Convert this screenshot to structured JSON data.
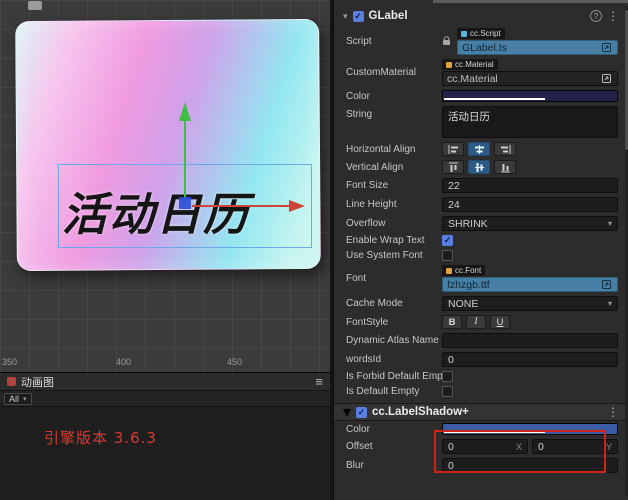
{
  "icons": {
    "menu_dots": "⋮",
    "hamburger": "≡",
    "chevron_down": "▾",
    "collapse_open": "▾",
    "help": "?",
    "check": "✓"
  },
  "colors": {
    "accent_blue": "#5a7fe0",
    "asset_highlight": "#477ea3",
    "annotation_red": "#cf2318",
    "label_color_value": "#23224A",
    "shadow_color_value": "#3D5CA6"
  },
  "scene": {
    "ruler_labels": [
      "350",
      "400",
      "450"
    ],
    "card_text": "活动日历",
    "timeline_tab": "动画图",
    "filter_value": "All",
    "annotation": "引擎版本 3.6.3"
  },
  "inspector": {
    "title": "GLabel",
    "fields": {
      "script": {
        "label": "Script",
        "type": "cc.Script",
        "value": "GLabel.ts"
      },
      "custom_material": {
        "label": "CustomMaterial",
        "type": "cc.Material",
        "value": "cc.Material"
      },
      "color": {
        "label": "Color",
        "value": "#23224A"
      },
      "string": {
        "label": "String",
        "value": "活动日历"
      },
      "horizontal_align": {
        "label": "Horizontal Align"
      },
      "vertical_align": {
        "label": "Vertical Align"
      },
      "font_size": {
        "label": "Font Size",
        "value": "22"
      },
      "line_height": {
        "label": "Line Height",
        "value": "24"
      },
      "overflow": {
        "label": "Overflow",
        "value": "SHRINK"
      },
      "enable_wrap_text": {
        "label": "Enable Wrap Text",
        "checked": true
      },
      "use_system_font": {
        "label": "Use System Font",
        "checked": false
      },
      "font": {
        "label": "Font",
        "type": "cc.Font",
        "value": "fzhzgb.ttf"
      },
      "cache_mode": {
        "label": "Cache Mode",
        "value": "NONE"
      },
      "font_style": {
        "label": "FontStyle",
        "buttons": [
          "B",
          "I",
          "U"
        ]
      },
      "dynamic_atlas_name": {
        "label": "Dynamic Atlas Name",
        "value": ""
      },
      "words_id": {
        "label": "wordsId",
        "value": "0"
      },
      "is_forbid_default_empty": {
        "label": "Is Forbid Default Empty",
        "checked": false
      },
      "is_default_empty": {
        "label": "Is Default Empty",
        "checked": false
      }
    },
    "shadow": {
      "title": "cc.LabelShadow+",
      "color": {
        "label": "Color",
        "value": "#3D5CA6"
      },
      "offset": {
        "label": "Offset",
        "x": "0",
        "y": "0",
        "x_suffix": "X",
        "y_suffix": "Y"
      },
      "blur": {
        "label": "Blur",
        "value": "0"
      }
    }
  }
}
